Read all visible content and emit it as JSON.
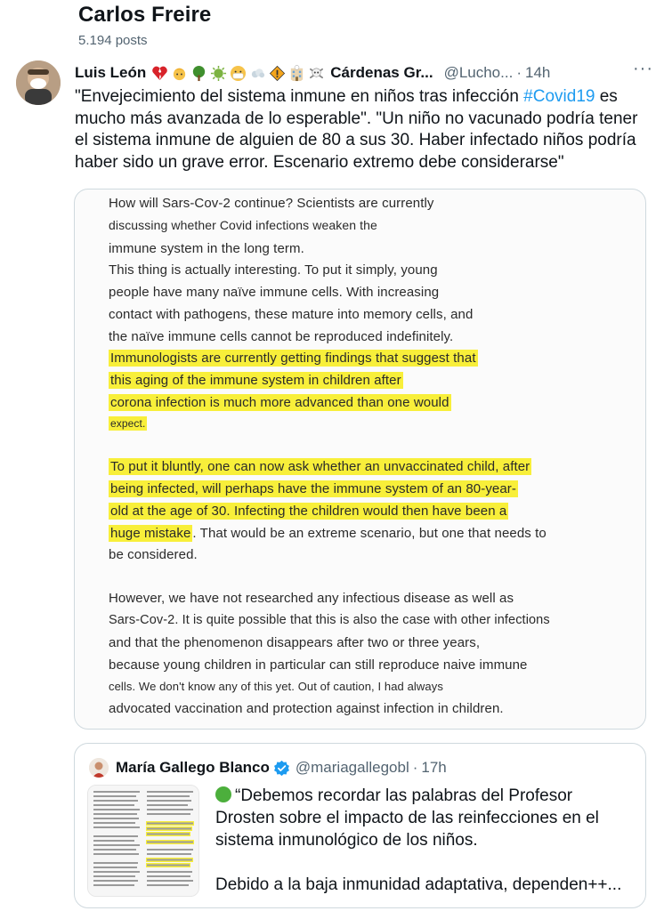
{
  "profile": {
    "name": "Carlos Freire",
    "posts": "5.194 posts"
  },
  "tweet": {
    "author_name": "Luis León",
    "author_name_tail": "Cárdenas Gr...",
    "handle": "@Lucho...",
    "separator": "·",
    "time": "14h",
    "more": "···",
    "text_part1": "\"Envejecimiento del sistema inmune en niños tras infección ",
    "hashtag": "#Covid19",
    "text_part2": " es mucho más avanzada de lo esperable\". \"Un niño no vacunado podría tener el sistema inmune de alguien de 80 a sus 30. Haber infectado niños podría haber sido un grave error. Escenario extremo debe considerarse\"",
    "emoji_icons": [
      "broken-heart-emoji",
      "baby-emoji",
      "tree-emoji",
      "virus-emoji",
      "mask-face-emoji",
      "breath-emoji",
      "warning-sign-emoji",
      "hospital-emoji",
      "skull-crossbones-emoji"
    ]
  },
  "media": {
    "lines": [
      "How will Sars-Cov-2 continue? Scientists are currently",
      "discussing whether Covid infections weaken the",
      "immune system in the long term.",
      "This thing is actually interesting. To put it simply, young",
      "people have many naïve immune cells. With increasing",
      "contact with pathogens, these mature into memory cells, and",
      "the naïve immune cells cannot be reproduced indefinitely.",
      "Immunologists are currently getting findings that suggest that",
      "this aging of the immune system in children after",
      "corona infection is much more advanced than one would",
      "expect.",
      "To put it bluntly, one can now ask whether an unvaccinated child, after",
      "being infected, will perhaps have the immune system of an 80-year-",
      "old at the age of 30. Infecting the children would then have been a",
      "huge mistake",
      ". That would be an extreme scenario, but one that needs to",
      "be considered.",
      "However, we have not researched any infectious disease as well as",
      "Sars-Cov-2. It is quite possible that this is also the case with other infections",
      "and that the phenomenon disappears after two or three years,",
      "because young children in particular can still reproduce naive immune",
      "cells. We don't know any of this yet. Out of caution, I had always",
      "advocated vaccination and protection against infection in children."
    ],
    "highlight_color": "#f8ef3a"
  },
  "quote": {
    "name": "María Gallego Blanco",
    "handle": "@mariagallegobl",
    "separator": "·",
    "time": "17h",
    "text_para1": "“Debemos recordar las palabras del Profesor Drosten sobre el impacto de las reinfecciones en el sistema inmunológico de los niños.",
    "text_para2": "Debido a la baja inmunidad adaptativa, dependen++..."
  },
  "colors": {
    "link": "#1d9bf0",
    "secondary_text": "#536471",
    "border": "#cfd9de",
    "verified": "#1d9bf0"
  }
}
